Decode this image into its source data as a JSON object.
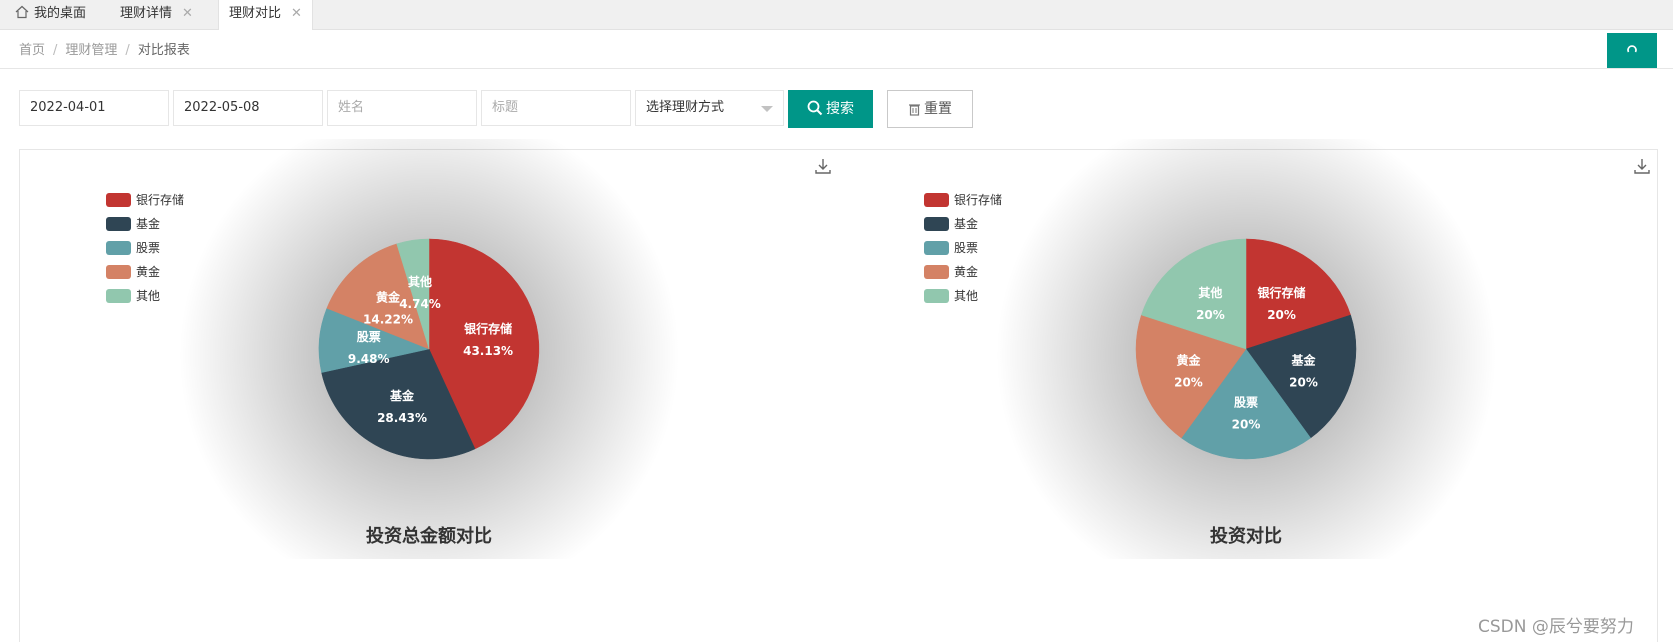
{
  "tabs": [
    {
      "label": "我的桌面",
      "icon": "home-icon",
      "closable": false,
      "active": false
    },
    {
      "label": "理财详情",
      "closable": true,
      "active": false
    },
    {
      "label": "理财对比",
      "closable": true,
      "active": true
    }
  ],
  "breadcrumb": {
    "items": [
      "首页",
      "理财管理",
      "对比报表"
    ],
    "separator": "/"
  },
  "refresh_icon": "refresh-icon",
  "filters": {
    "start_date": "2022-04-01",
    "end_date": "2022-05-08",
    "name_placeholder": "姓名",
    "title_placeholder": "标题",
    "method_select": "选择理财方式",
    "search_label": "搜索",
    "reset_label": "重置"
  },
  "colors": {
    "accent": "#009688",
    "bank": "#c23531",
    "fund": "#2f4554",
    "stock": "#61a0a8",
    "gold": "#d48265",
    "other": "#91c7ae"
  },
  "watermark": "CSDN @辰兮要努力",
  "chart_data": [
    {
      "type": "pie",
      "title": "投资总金额对比",
      "legend": [
        "银行存储",
        "基金",
        "股票",
        "黄金",
        "其他"
      ],
      "legend_position": "top-left",
      "values": [
        43.13,
        28.43,
        9.48,
        14.22,
        4.74
      ],
      "value_labels": [
        "43.13%",
        "28.43%",
        "9.48%",
        "14.22%",
        "4.74%"
      ]
    },
    {
      "type": "pie",
      "title": "投资对比",
      "legend": [
        "银行存储",
        "基金",
        "股票",
        "黄金",
        "其他"
      ],
      "legend_position": "top-left",
      "values": [
        20,
        20,
        20,
        20,
        20
      ],
      "value_labels": [
        "20%",
        "20%",
        "20%",
        "20%",
        "20%"
      ]
    }
  ]
}
